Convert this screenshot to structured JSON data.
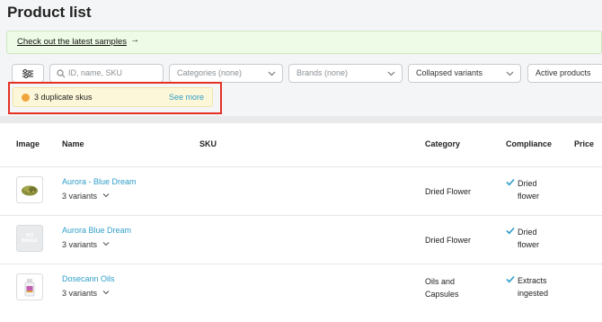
{
  "page": {
    "title": "Product list"
  },
  "banner": {
    "link_text": "Check out the latest samples",
    "arrow": "→"
  },
  "filters": {
    "search_placeholder": "ID, name, SKU",
    "categories_placeholder": "Categories (none)",
    "brands_placeholder": "Brands (none)",
    "variants_value": "Collapsed variants",
    "products_value": "Active products"
  },
  "duplicates": {
    "message": "3 duplicate skus",
    "see_more": "See more"
  },
  "table": {
    "headers": {
      "image": "Image",
      "name": "Name",
      "sku": "SKU",
      "category": "Category",
      "compliance": "Compliance",
      "price": "Price"
    },
    "rows": [
      {
        "name": "Aurora - Blue Dream",
        "variants": "3 variants",
        "category_line1": "Dried Flower",
        "category_line2": "",
        "compliance_line1": "Dried",
        "compliance_line2": "flower",
        "image": "cannabis-flower"
      },
      {
        "name": "Aurora Blue Dream",
        "variants": "3 variants",
        "category_line1": "Dried Flower",
        "category_line2": "",
        "compliance_line1": "Dried",
        "compliance_line2": "flower",
        "image": "no-image",
        "no_image_1": "NO",
        "no_image_2": "IMAGE"
      },
      {
        "name": "Dosecann Oils",
        "variants": "3 variants",
        "category_line1": "Oils and",
        "category_line2": "Capsules",
        "compliance_line1": "Extracts",
        "compliance_line2": "ingested",
        "image": "oil-bottle"
      }
    ]
  },
  "colors": {
    "accent": "#2f9ec7",
    "warning": "#f0a53a",
    "highlight": "#e53124",
    "banner_bg": "#eefbe6"
  }
}
